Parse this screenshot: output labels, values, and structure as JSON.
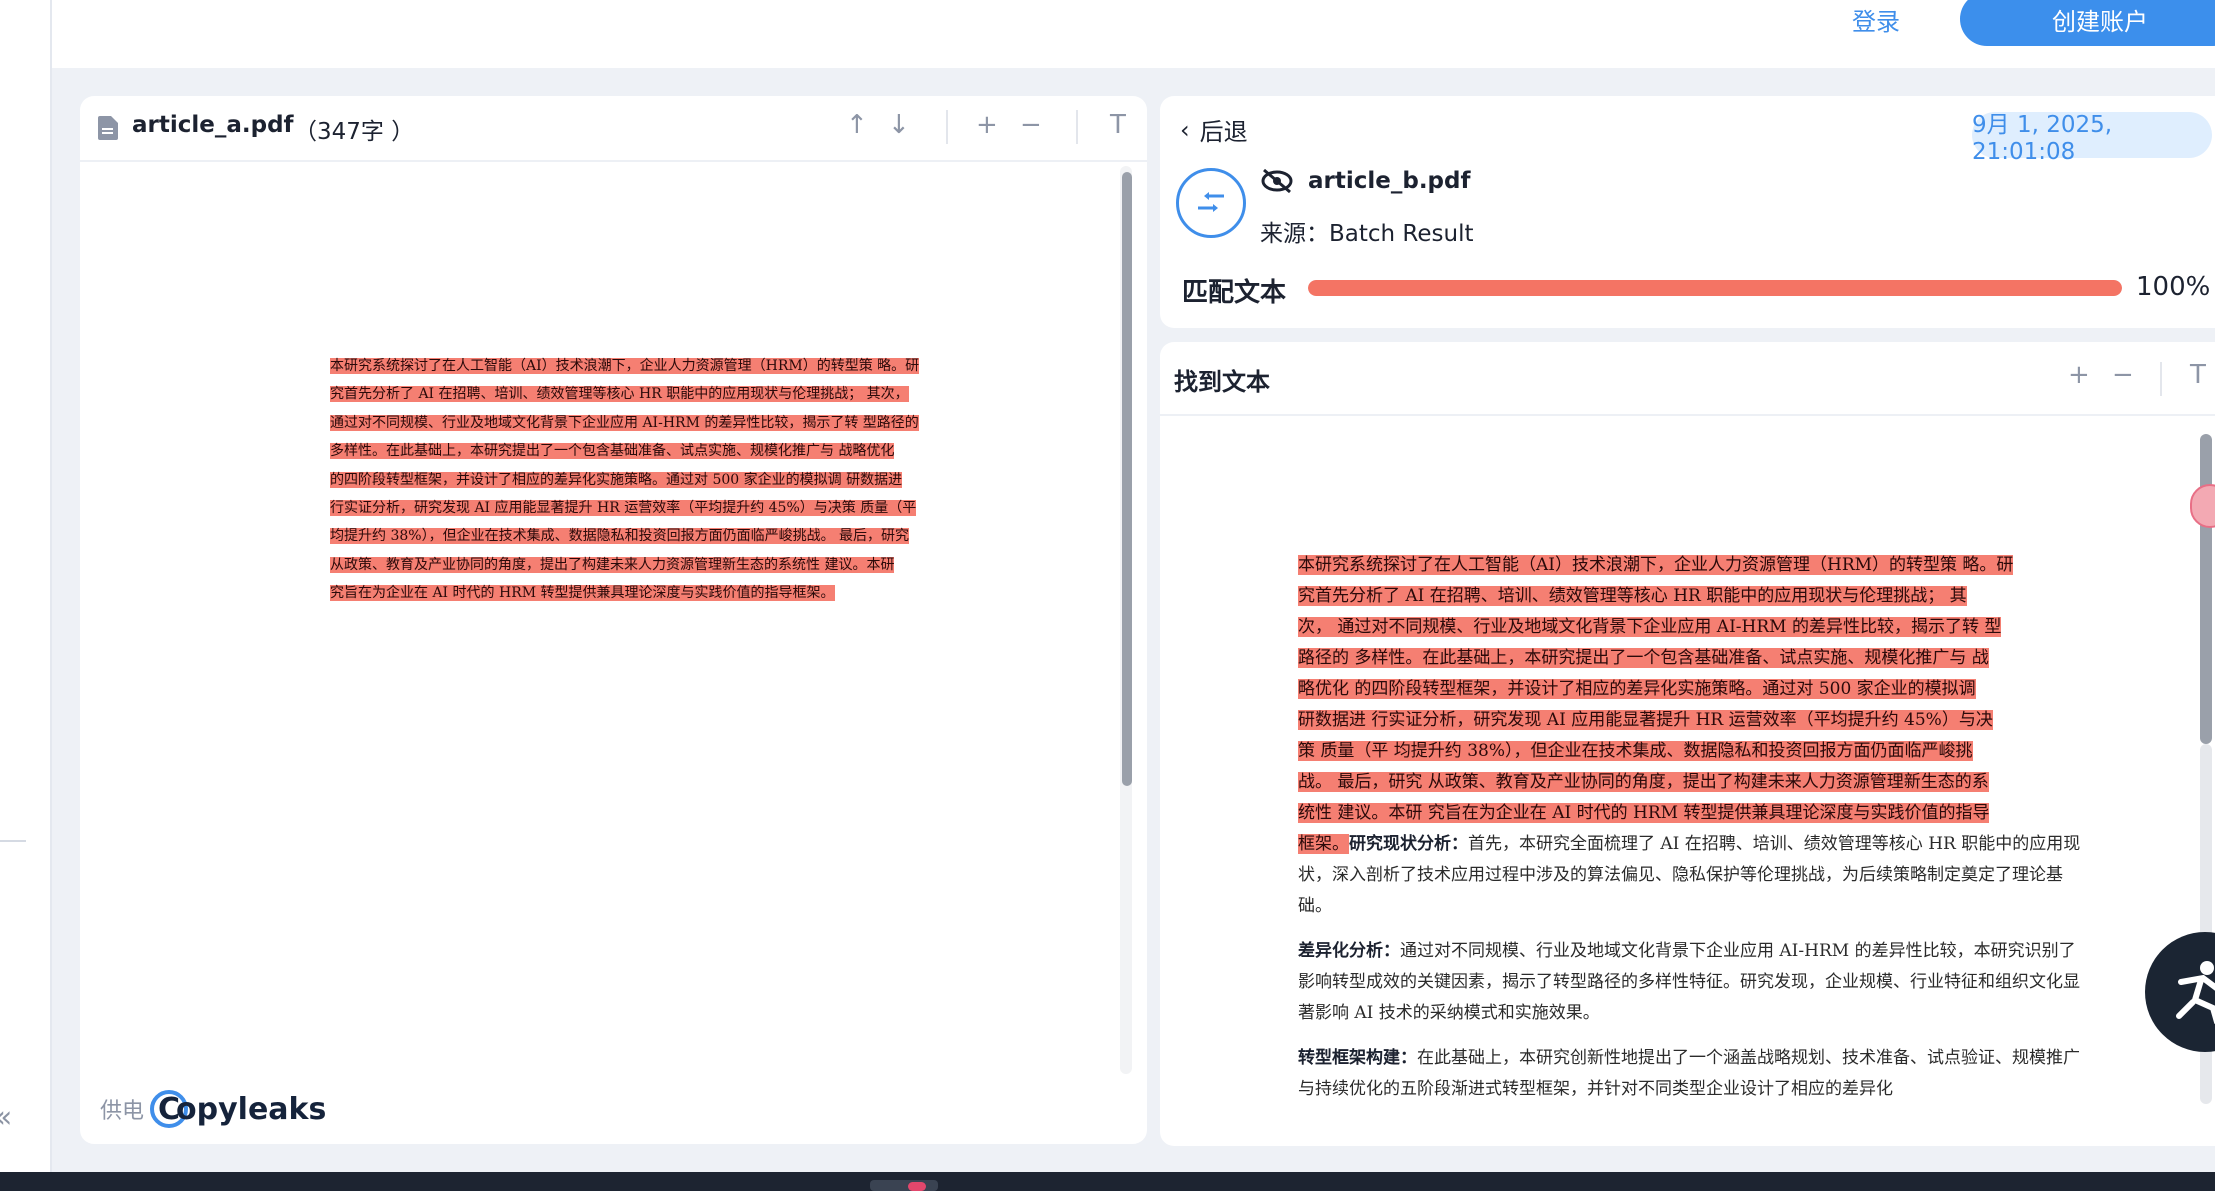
{
  "header": {
    "login_label": "登录",
    "create_account_label": "创建账户"
  },
  "doc_a": {
    "filename": "article_a.pdf",
    "word_count": "（347字 ）",
    "toolbar": {
      "prev_icon": "arrow-up-icon",
      "next_icon": "arrow-down-icon",
      "zoom_in_icon": "plus-icon",
      "zoom_out_icon": "minus-icon",
      "text_mode_icon": "text-icon"
    },
    "lines": [
      "本研究系统探讨了在人工智能（AI）技术浪潮下，企业人力资源管理（HRM）的转型策 略。研",
      "究首先分析了 AI 在招聘、培训、绩效管理等核心 HR 职能中的应用现状与伦理挑战； 其次，",
      "通过对不同规模、行业及地域文化背景下企业应用 AI-HRM 的差异性比较，揭示了转 型路径的",
      "多样性。在此基础上，本研究提出了一个包含基础准备、试点实施、规模化推广与 战略优化",
      "的四阶段转型框架，并设计了相应的差异化实施策略。通过对 500 家企业的模拟调 研数据进",
      "行实证分析，研究发现 AI 应用能显著提升 HR 运营效率（平均提升约 45%）与决策 质量（平",
      "均提升约 38%），但企业在技术集成、数据隐私和投资回报方面仍面临严峻挑战。 最后，研究",
      "从政策、教育及产业协同的角度，提出了构建未来人力资源管理新生态的系统性 建议。本研",
      "究旨在为企业在 AI 时代的 HRM 转型提供兼具理论深度与实践价值的指导框架。"
    ],
    "powered_by_label": "供电",
    "logo_text": "opyleaks"
  },
  "doc_b": {
    "back_label": "后退",
    "date": "9月 1, 2025, 21:01:08",
    "filename": "article_b.pdf",
    "source": "来源：Batch Result",
    "match_label": "匹配文本",
    "match_percent": "100%",
    "match_fraction": 1.0,
    "found_title": "找到文本",
    "highlighted_lines": [
      "本研究系统探讨了在人工智能（AI）技术浪潮下，企业人力资源管理（HRM）的转型策 略。研",
      "究首先分析了 AI 在招聘、培训、绩效管理等核心 HR 职能中的应用现状与伦理挑战； 其",
      "次， 通过对不同规模、行业及地域文化背景下企业应用 AI-HRM 的差异性比较，揭示了转 型",
      "路径的 多样性。在此基础上，本研究提出了一个包含基础准备、试点实施、规模化推广与 战",
      "略优化 的四阶段转型框架，并设计了相应的差异化实施策略。通过对 500 家企业的模拟调",
      "研数据进 行实证分析，研究发现 AI 应用能显著提升 HR 运营效率（平均提升约 45%）与决",
      "策 质量（平 均提升约 38%），但企业在技术集成、数据隐私和投资回报方面仍面临严峻挑",
      "战。 最后，研究 从政策、教育及产业协同的角度，提出了构建未来人力资源管理新生态的系",
      "统性 建议。本研 究旨在为企业在 AI 时代的 HRM 转型提供兼具理论深度与实践价值的指导",
      "框架。"
    ],
    "para1_term": "研究现状分析：",
    "para1_text": "首先，本研究全面梳理了 AI 在招聘、培训、绩效管理等核心 HR 职能中的应用现状，深入剖析了技术应用过程中涉及的算法偏见、隐私保护等伦理挑战，为后续策略制定奠定了理论基础。",
    "para2_term": "差异化分析：",
    "para2_text": "通过对不同规模、行业及地域文化背景下企业应用 AI-HRM 的差异性比较，本研究识别了影响转型成效的关键因素，揭示了转型路径的多样性特征。研究发现，企业规模、行业特征和组织文化显著影响 AI 技术的采纳模式和实施效果。",
    "para3_term": "转型框架构建：",
    "para3_text": "在此基础上，本研究创新性地提出了一个涵盖战略规划、技术准备、试点验证、规模推广与持续优化的五阶段渐进式转型框架，并针对不同类型企业设计了相应的差异化"
  },
  "colors": {
    "accent": "#3c8fec",
    "highlight": "#f57f72",
    "progress": "#f47464"
  }
}
